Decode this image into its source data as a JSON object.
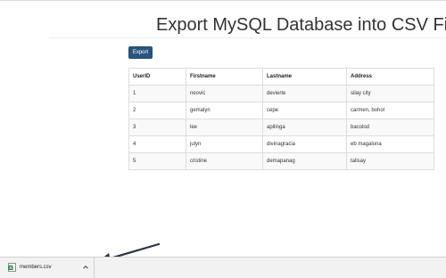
{
  "page": {
    "title": "Export MySQL Database into CSV File",
    "export_label": "Export"
  },
  "table": {
    "columns": [
      "UserID",
      "Firstname",
      "Lastname",
      "Address"
    ],
    "rows": [
      [
        "1",
        "neovic",
        "devierte",
        "silay city"
      ],
      [
        "2",
        "gemalyn",
        "cepe",
        "carmen, bohol"
      ],
      [
        "3",
        "lee",
        "apilinga",
        "bacolod"
      ],
      [
        "4",
        "julyn",
        "divinagracia",
        "eb magalona"
      ],
      [
        "5",
        "cristine",
        "demapanag",
        "talisay"
      ]
    ]
  },
  "download_bar": {
    "file_name": "members.csv",
    "file_icon": "csv-file-icon",
    "menu_icon": "chevron-up-icon"
  },
  "annotation": {
    "arrow_color": "#2b3445"
  },
  "colors": {
    "button": "#28557f",
    "download_bar": "#f2f2f2",
    "table_stripe": "#f9f9f9"
  }
}
